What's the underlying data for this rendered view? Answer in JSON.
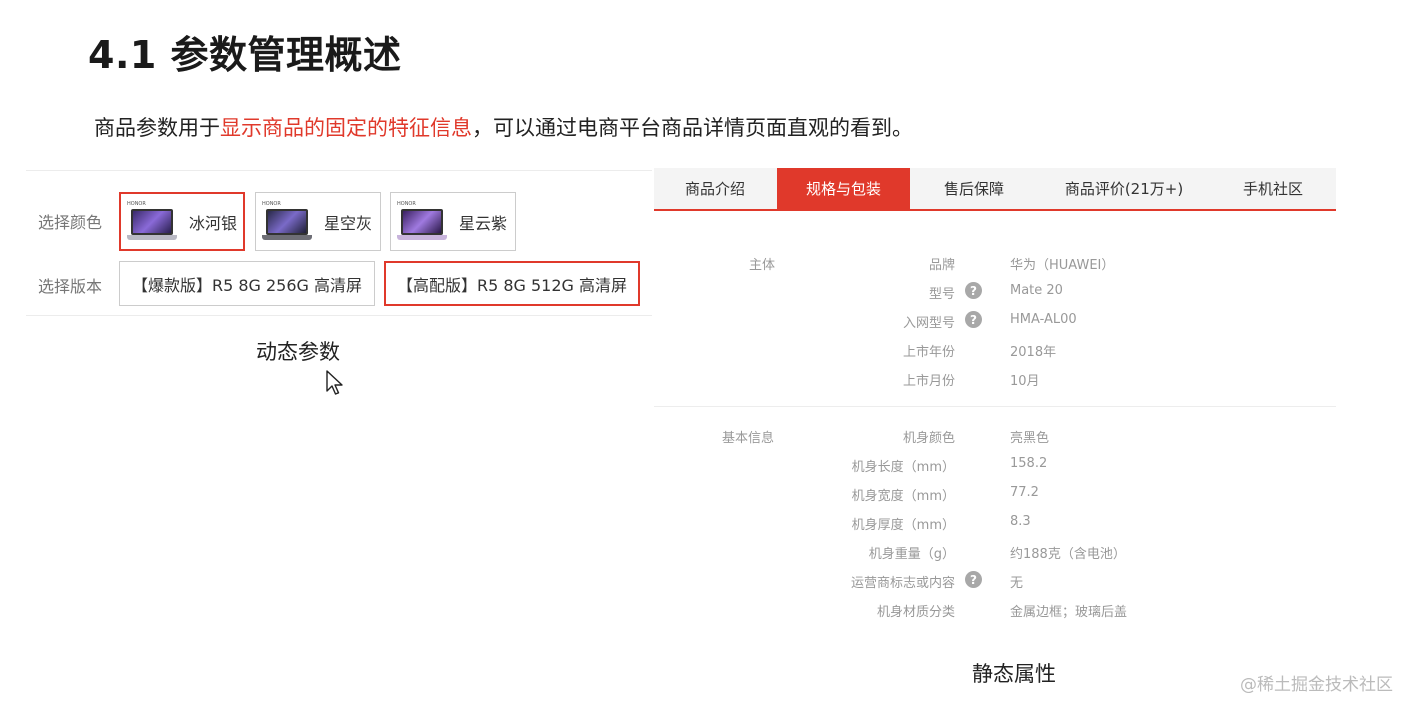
{
  "heading": {
    "title": "4.1 参数管理概述"
  },
  "intro": {
    "before": "商品参数用于",
    "highlight": "显示商品的固定的特征信息",
    "after": "，可以通过电商平台商品详情页面直观的看到。"
  },
  "dynamic": {
    "color_label": "选择颜色",
    "version_label": "选择版本",
    "colors": [
      {
        "brand": "HONOR",
        "name": "冰河银",
        "selected": true
      },
      {
        "brand": "HONOR",
        "name": "星空灰",
        "selected": false
      },
      {
        "brand": "HONOR",
        "name": "星云紫",
        "selected": false
      }
    ],
    "versions": [
      {
        "label": "【爆款版】R5 8G 256G 高清屏",
        "selected": false
      },
      {
        "label": "【高配版】R5 8G 512G 高清屏",
        "selected": true
      }
    ],
    "caption": "动态参数"
  },
  "static": {
    "tabs": [
      "商品介绍",
      "规格与包装",
      "售后保障",
      "商品评价(21万+)",
      "手机社区"
    ],
    "active_tab": "规格与包装",
    "groups": [
      {
        "label": "主体",
        "rows": [
          {
            "key": "品牌",
            "value": "华为（HUAWEI）",
            "help": false
          },
          {
            "key": "型号",
            "value": "Mate 20",
            "help": true
          },
          {
            "key": "入网型号",
            "value": "HMA-AL00",
            "help": true
          },
          {
            "key": "上市年份",
            "value": "2018年",
            "help": false
          },
          {
            "key": "上市月份",
            "value": "10月",
            "help": false
          }
        ]
      },
      {
        "label": "基本信息",
        "rows": [
          {
            "key": "机身颜色",
            "value": "亮黑色",
            "help": false
          },
          {
            "key": "机身长度（mm）",
            "value": "158.2",
            "help": false
          },
          {
            "key": "机身宽度（mm）",
            "value": "77.2",
            "help": false
          },
          {
            "key": "机身厚度（mm）",
            "value": "8.3",
            "help": false
          },
          {
            "key": "机身重量（g）",
            "value": "约188克（含电池）",
            "help": false
          },
          {
            "key": "运营商标志或内容",
            "value": "无",
            "help": true
          },
          {
            "key": "机身材质分类",
            "value": "金属边框；玻璃后盖",
            "help": false
          }
        ]
      }
    ],
    "help_glyph": "?",
    "caption": "静态属性"
  },
  "watermark": "@稀土掘金技术社区",
  "colors": {
    "accent": "#e0392b"
  }
}
